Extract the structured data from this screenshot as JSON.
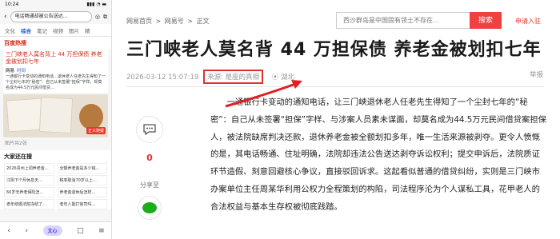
{
  "phone": {
    "time": "10:24",
    "signal": "▮▮▮ ◔ ▬",
    "url": "电话畅通却被公告送达…",
    "tabs": [
      {
        "label": "文化"
      },
      {
        "label": "综合"
      },
      {
        "label": "笔记"
      },
      {
        "label": "视频"
      },
      {
        "label": "图片"
      },
      {
        "label": "精"
      }
    ],
    "hot_title": "百度热搜",
    "card": {
      "title": "三门峡老人莫名背上 44 万担保债 养老金被划扣七年",
      "meta": "网易",
      "meta_link": "时间",
      "body": "一通银行卡变动的通知电话…退休老人任老先生得知了一个尘封七年的“秘密”：自己从未签署“担保”字样，却莫名成为44.5万元民间借贷…"
    },
    "card_badge": "正义驰援",
    "caption": "图片共2张",
    "all_title": "大家还在搜",
    "grid": [
      "2026贵州上调养老金…",
      "全额养老金是多少钱…",
      "江阴下个月休息天…",
      "税率取消70岁以上…",
      "60岁无养老保险怎…",
      "养老金退休后怎样…",
      "老年结婚法院冻结了…",
      "老年人能打官司吗…"
    ],
    "pill": "文心"
  },
  "main": {
    "breadcrumb": [
      "网易首页",
      ">",
      "网易号",
      ">",
      "正文"
    ],
    "search_placeholder": "西沙群岛是中国固有领土不存在…",
    "search_button": "搜索",
    "editor_link": "申请入驻",
    "headline": "三门峡老人莫名背 44 万担保债 养老金被划扣七年",
    "date": "2026-03-12 15:07:19",
    "source": "来源: 是座的真相",
    "location": "湖北",
    "report": "举报",
    "comment_count": "0",
    "share_label": "分享至",
    "article": "一通银行卡变动的通知电话，让三门峡退休老人任老先生得知了一个尘封七年的“秘密”：自己从未签署“担保”字样、与涉案人员素未谋面，却莫名成为44.5万元民间借贷案担保人，被法院缺席判决还款，退休养老金被全额划扣多年，唯一生活来源被剥夺。更令人愤慨的是，其电话畅通、住址明确，法院却违法公告送达剥夺诉讼权利；提交申诉后，法院质证环节造假、刻意回避核心争议，直接驳回诉求。这起看似普通的借贷纠纷，实则是三门峡市办案单位主任周某华利用公权力全程策划的构陷，司法程序沦为个人谋私工具，花甲老人的合法权益与基本生存权被彻底践踏。"
  },
  "colors": {
    "accent": "#e03030",
    "link": "#1a5bd0"
  }
}
